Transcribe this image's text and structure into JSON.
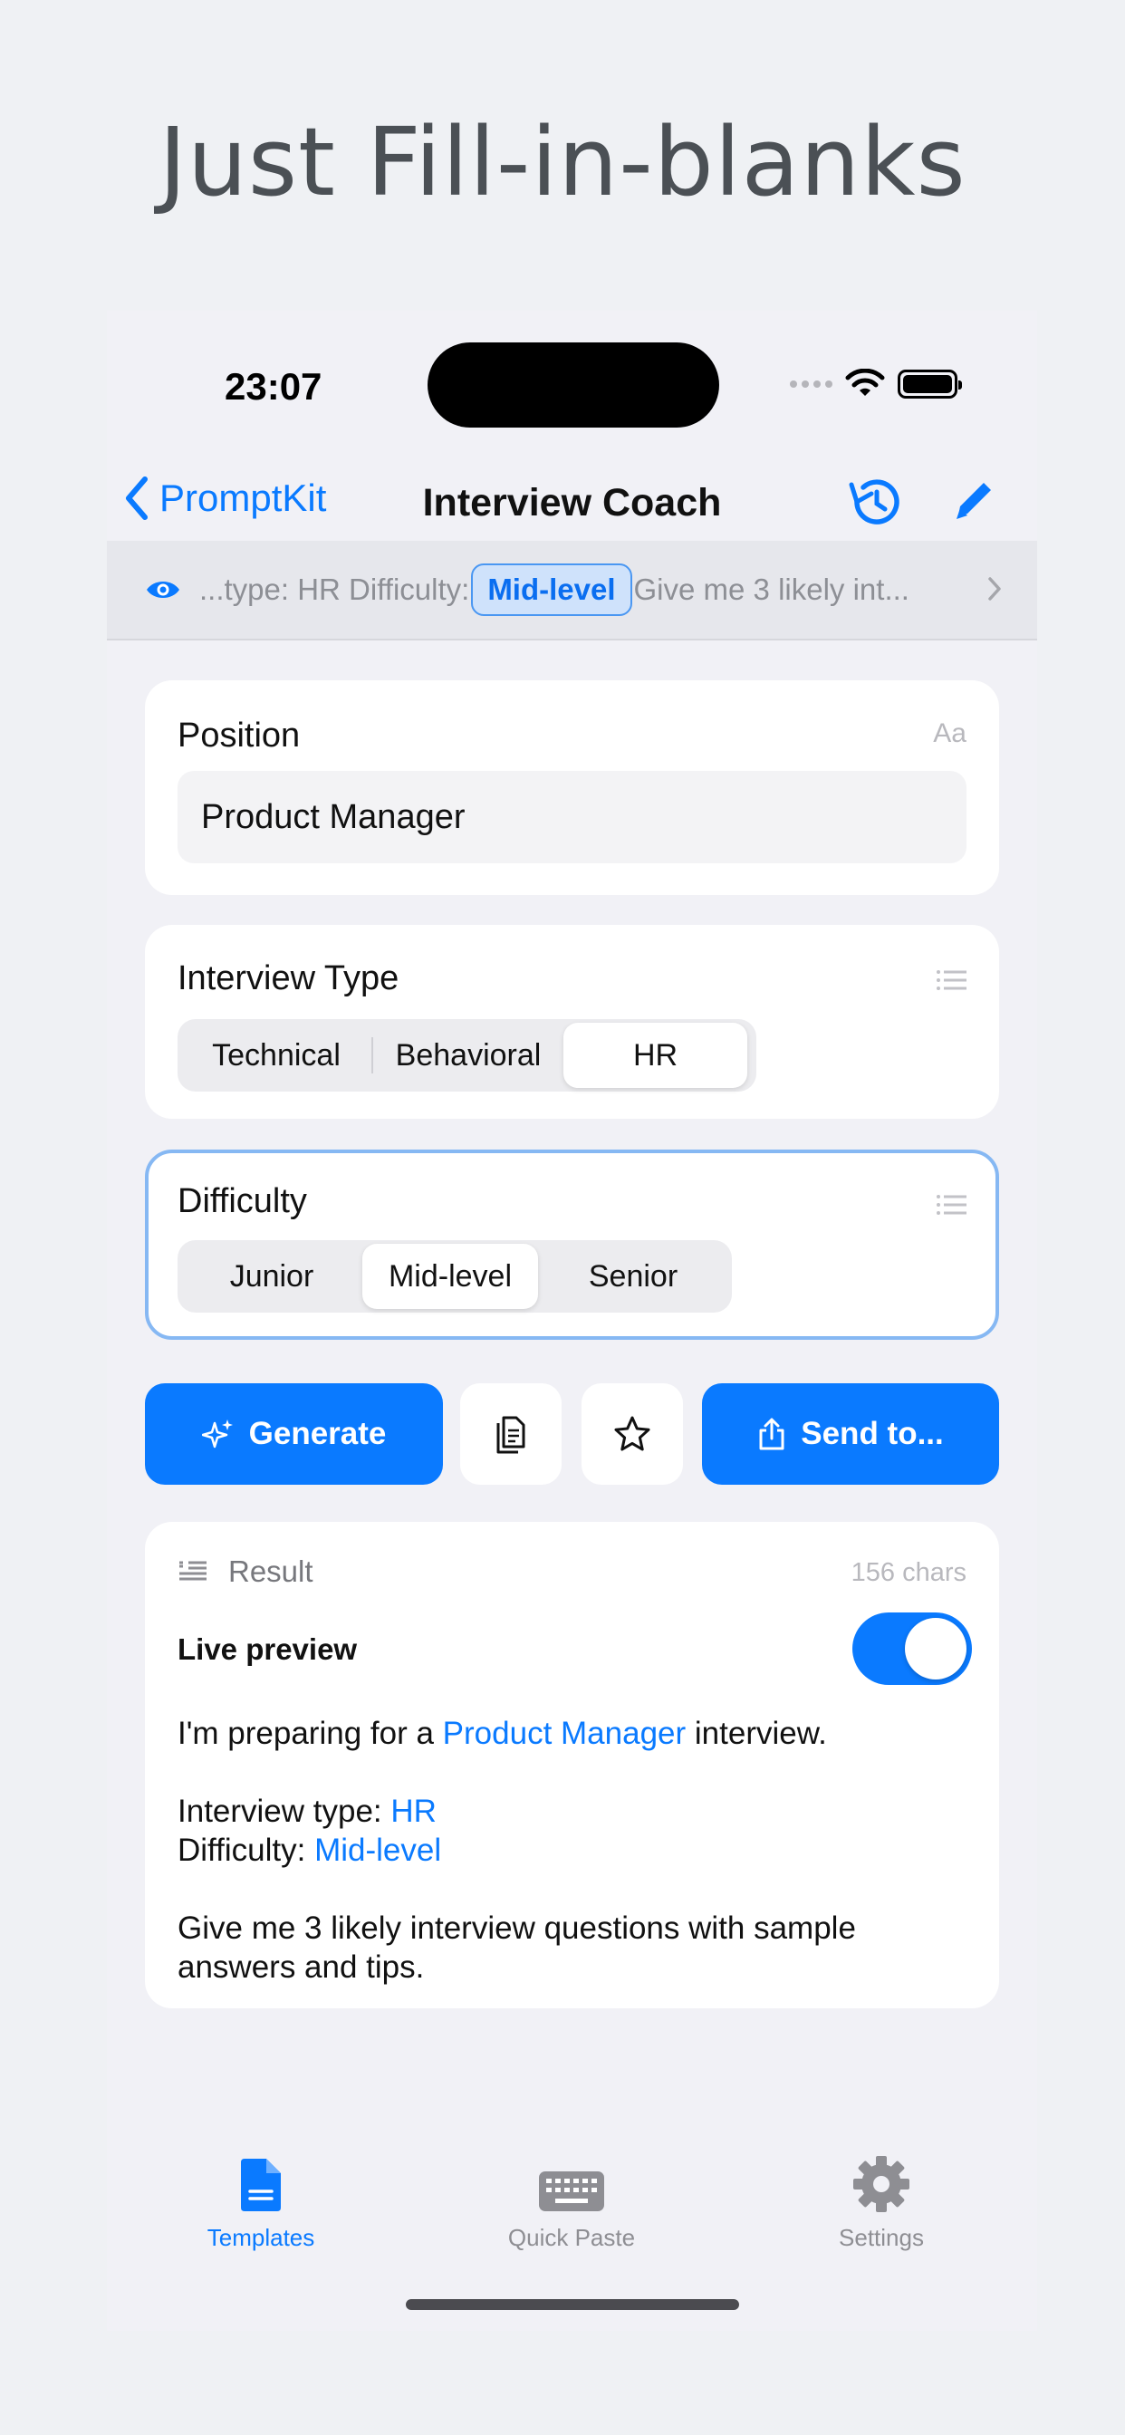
{
  "headline": "Just Fill-in-blanks",
  "status": {
    "time": "23:07"
  },
  "nav": {
    "back_label": "PromptKit",
    "title": "Interview Coach"
  },
  "preview": {
    "before": "...type: HR Difficulty:",
    "highlight": "Mid-level",
    "after": "Give me 3 likely int..."
  },
  "fields": {
    "position": {
      "label": "Position",
      "type_badge": "Aa",
      "value": "Product Manager"
    },
    "interview_type": {
      "label": "Interview Type",
      "options": [
        "Technical",
        "Behavioral",
        "HR"
      ],
      "selected": "HR"
    },
    "difficulty": {
      "label": "Difficulty",
      "options": [
        "Junior",
        "Mid-level",
        "Senior"
      ],
      "selected": "Mid-level"
    }
  },
  "actions": {
    "generate_label": "Generate",
    "send_label": "Send to..."
  },
  "result": {
    "label": "Result",
    "chars": "156 chars",
    "live_preview_label": "Live preview",
    "live_preview_on": true,
    "line1_prefix": "I'm preparing for a",
    "line1_value": "Product Manager",
    "line1_suffix": "interview.",
    "line2_prefix": "Interview type:",
    "line2_value": "HR",
    "line3_prefix": "Difficulty:",
    "line3_value": "Mid-level",
    "line4": "Give me 3 likely interview questions with sample answers and tips."
  },
  "tabs": [
    {
      "label": "Templates",
      "icon": "document-icon",
      "active": true
    },
    {
      "label": "Quick Paste",
      "icon": "keyboard-icon",
      "active": false
    },
    {
      "label": "Settings",
      "icon": "gear-icon",
      "active": false
    }
  ],
  "colors": {
    "accent": "#0a7aff",
    "background": "#eff1f4"
  }
}
